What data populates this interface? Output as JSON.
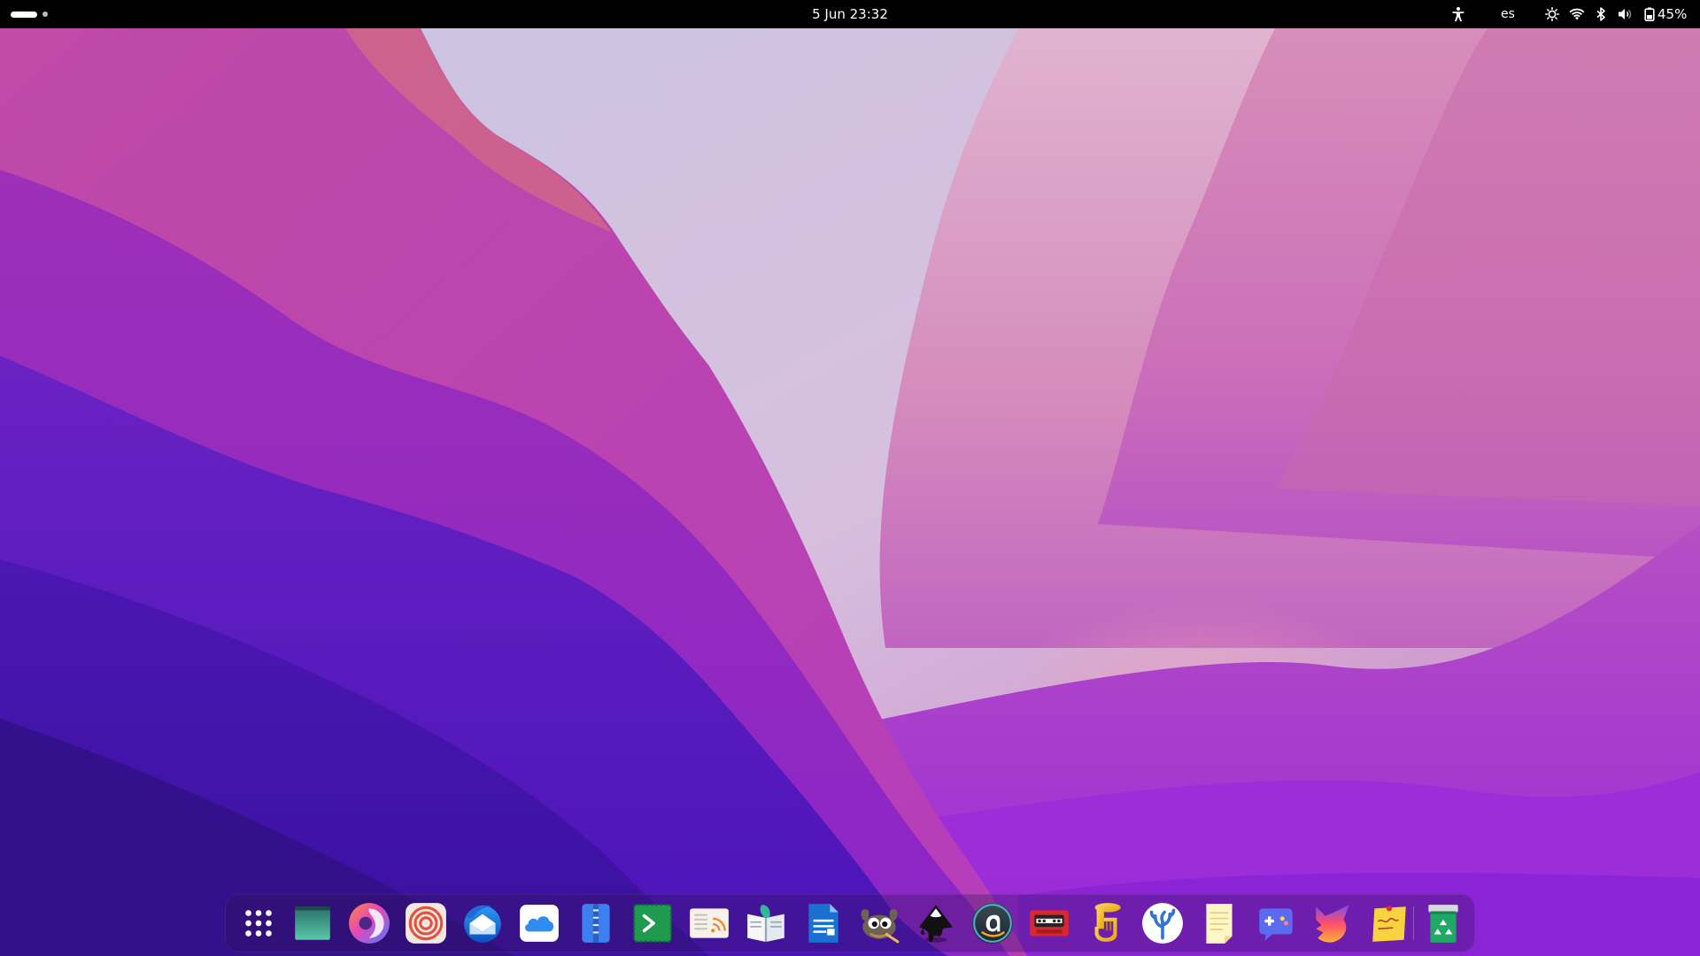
{
  "topbar": {
    "clock": "5 Jun  23:32",
    "language": "es",
    "battery_percent": "45%",
    "icons": [
      "activities-indicator",
      "accessibility-icon",
      "brightness-icon",
      "wifi-icon",
      "bluetooth-icon",
      "volume-icon",
      "battery-icon"
    ]
  },
  "dock": {
    "apps": [
      {
        "name": "Show Applications",
        "icon": "app-grid-icon"
      },
      {
        "name": "Desktop",
        "icon": "desktop-icon"
      },
      {
        "name": "Web Browser",
        "icon": "browser-icon"
      },
      {
        "name": "Ring App",
        "icon": "ring-icon"
      },
      {
        "name": "Mail Client",
        "icon": "bird-mail-icon"
      },
      {
        "name": "Cloud Storage",
        "icon": "cloud-icon"
      },
      {
        "name": "Archive Manager",
        "icon": "zipper-icon"
      },
      {
        "name": "Terminal",
        "icon": "terminal-icon"
      },
      {
        "name": "Feed Reader",
        "icon": "rss-icon"
      },
      {
        "name": "E-Book Reader",
        "icon": "book-icon"
      },
      {
        "name": "Writer",
        "icon": "document-icon"
      },
      {
        "name": "GIMP",
        "icon": "gimp-icon"
      },
      {
        "name": "Inkscape",
        "icon": "inkscape-icon"
      },
      {
        "name": "Amazon",
        "icon": "amazon-icon"
      },
      {
        "name": "Cassette Player",
        "icon": "cassette-icon"
      },
      {
        "name": "Tuba",
        "icon": "tuba-icon"
      },
      {
        "name": "Coral App",
        "icon": "coral-icon"
      },
      {
        "name": "Notes",
        "icon": "notes-icon"
      },
      {
        "name": "Game Hub",
        "icon": "gamepad-icon"
      },
      {
        "name": "Fox App",
        "icon": "fox-icon"
      },
      {
        "name": "Sticky Notes",
        "icon": "sticky-note-icon"
      },
      {
        "name": "Trash",
        "icon": "trash-icon"
      }
    ]
  },
  "colors": {
    "topbar": "#000000",
    "wallpaper_deep": "#3a1a9e",
    "wallpaper_magenta": "#c23fb0",
    "wallpaper_light": "#d7c4e4"
  }
}
